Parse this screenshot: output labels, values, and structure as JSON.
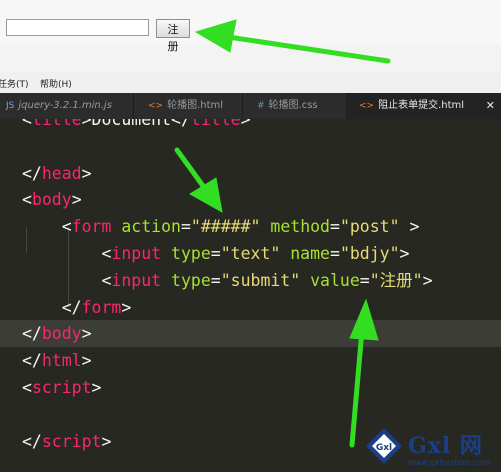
{
  "preview": {
    "input_value": "",
    "submit_label": "注册"
  },
  "menubar": {
    "items": [
      "任务(T)",
      "帮助(H)"
    ]
  },
  "tabs": [
    {
      "icon": "JS",
      "label": "jquery-3.2.1.min.js",
      "active": false
    },
    {
      "icon": "<>",
      "label": "轮播图.html",
      "active": false
    },
    {
      "icon": "#",
      "label": "轮播图.css",
      "active": false
    },
    {
      "icon": "<>",
      "label": "阻止表单提交.html",
      "active": true
    }
  ],
  "tab_close": "✕",
  "editor": {
    "lines": [
      {
        "t": [
          [
            "punc",
            "<"
          ],
          [
            "tag",
            "title"
          ],
          [
            "punc",
            ">Document</"
          ],
          [
            "tag",
            "title"
          ],
          [
            "punc",
            ">"
          ]
        ]
      },
      {
        "t": []
      },
      {
        "t": [
          [
            "punc",
            "</"
          ],
          [
            "tag",
            "head"
          ],
          [
            "punc",
            ">"
          ]
        ]
      },
      {
        "t": [
          [
            "punc",
            "<"
          ],
          [
            "tag",
            "body"
          ],
          [
            "punc",
            ">"
          ]
        ]
      },
      {
        "t": [
          [
            "punc",
            "    <"
          ],
          [
            "tag",
            "form"
          ],
          [
            "punc",
            " "
          ],
          [
            "attr",
            "action"
          ],
          [
            "punc",
            "="
          ],
          [
            "str",
            "\"#####\""
          ],
          [
            "punc",
            " "
          ],
          [
            "attr",
            "method"
          ],
          [
            "punc",
            "="
          ],
          [
            "str",
            "\"post\""
          ],
          [
            "punc",
            " >"
          ]
        ]
      },
      {
        "t": [
          [
            "punc",
            "        <"
          ],
          [
            "tag",
            "input"
          ],
          [
            "punc",
            " "
          ],
          [
            "attr",
            "type"
          ],
          [
            "punc",
            "="
          ],
          [
            "str",
            "\"text\""
          ],
          [
            "punc",
            " "
          ],
          [
            "attr",
            "name"
          ],
          [
            "punc",
            "="
          ],
          [
            "str",
            "\"bdjy\""
          ],
          [
            "punc",
            ">"
          ]
        ]
      },
      {
        "t": [
          [
            "punc",
            "        <"
          ],
          [
            "tag",
            "input"
          ],
          [
            "punc",
            " "
          ],
          [
            "attr",
            "type"
          ],
          [
            "punc",
            "="
          ],
          [
            "str",
            "\"submit\""
          ],
          [
            "punc",
            " "
          ],
          [
            "attr",
            "value"
          ],
          [
            "punc",
            "="
          ],
          [
            "str",
            "\"注册\""
          ],
          [
            "punc",
            ">"
          ]
        ]
      },
      {
        "t": [
          [
            "punc",
            "    </"
          ],
          [
            "tag",
            "form"
          ],
          [
            "punc",
            ">"
          ]
        ]
      },
      {
        "t": [
          [
            "punc",
            "</"
          ],
          [
            "tag",
            "body"
          ],
          [
            "punc",
            ">"
          ]
        ]
      },
      {
        "t": [
          [
            "punc",
            "</"
          ],
          [
            "tag",
            "html"
          ],
          [
            "punc",
            ">"
          ]
        ]
      },
      {
        "t": [
          [
            "punc",
            "<"
          ],
          [
            "tag",
            "script"
          ],
          [
            "punc",
            ">"
          ]
        ]
      },
      {
        "t": []
      },
      {
        "t": [
          [
            "punc",
            "</"
          ],
          [
            "tag",
            "script"
          ],
          [
            "punc",
            ">"
          ]
        ]
      }
    ]
  },
  "watermark": {
    "title": "Gxl 网",
    "url": "www.gxlsystem.com"
  },
  "colors": {
    "editor_bg": "#272822",
    "tag": "#f92672",
    "attr": "#a6e22e",
    "string": "#e6db74",
    "arrow": "#33dd22"
  }
}
